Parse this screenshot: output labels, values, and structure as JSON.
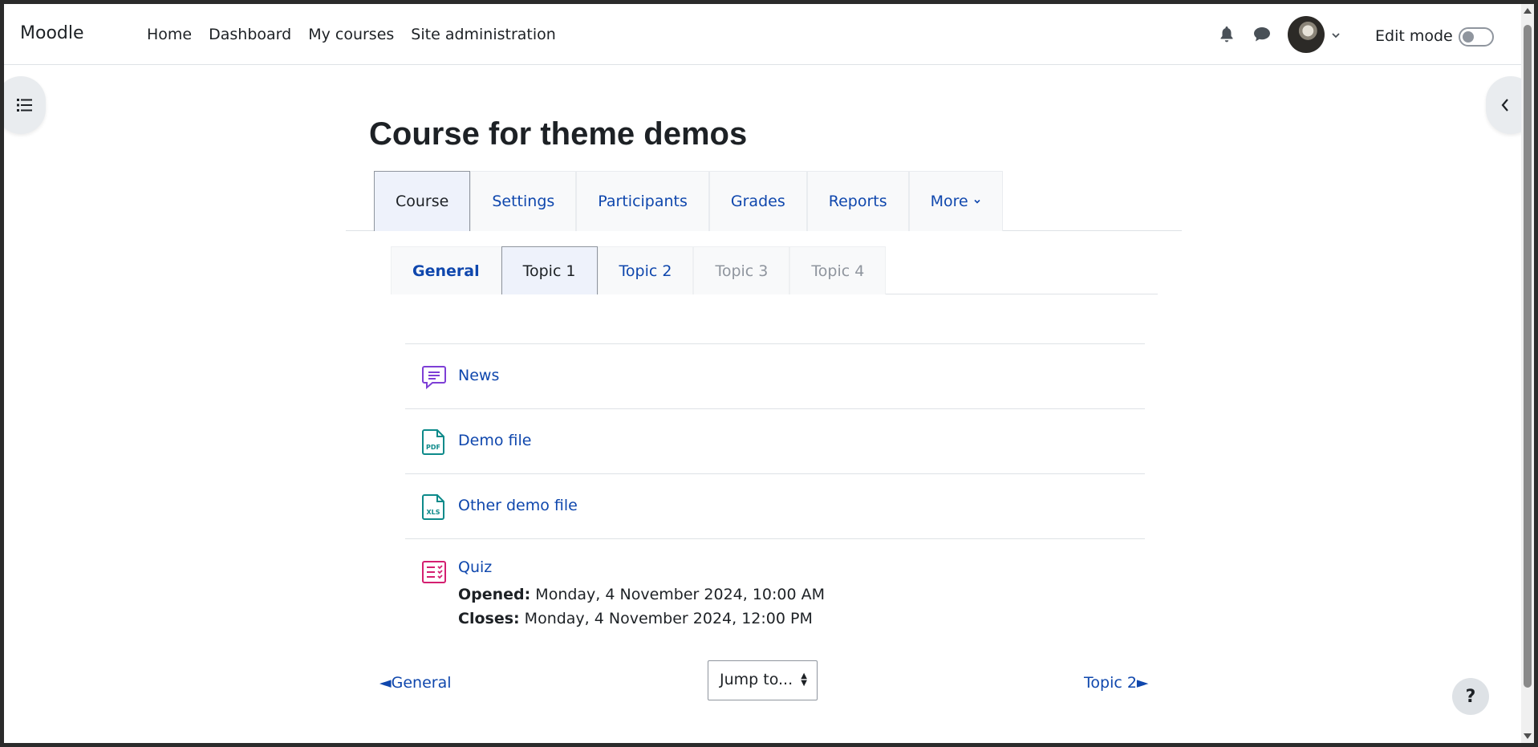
{
  "navbar": {
    "brand": "Moodle",
    "links": [
      "Home",
      "Dashboard",
      "My courses",
      "Site administration"
    ],
    "edit_mode_label": "Edit mode",
    "edit_mode_on": false,
    "icons": [
      "bell-icon",
      "chat-icon",
      "avatar",
      "chevron-down-icon"
    ]
  },
  "page": {
    "title": "Course for theme demos"
  },
  "course_tabs": {
    "items": [
      "Course",
      "Settings",
      "Participants",
      "Grades",
      "Reports",
      "More"
    ],
    "active": "Course"
  },
  "section_tabs": {
    "items": [
      "General",
      "Topic 1",
      "Topic 2",
      "Topic 3",
      "Topic 4"
    ],
    "active": "Topic 1",
    "disabled": [
      "Topic 3",
      "Topic 4"
    ]
  },
  "activities": [
    {
      "name": "News",
      "icon": "forum-icon",
      "icon_color": "#7e3fd6"
    },
    {
      "name": "Demo file",
      "icon": "pdf-file-icon",
      "icon_label": "PDF",
      "icon_color": "#0d8a8a"
    },
    {
      "name": "Other demo file",
      "icon": "xls-file-icon",
      "icon_label": "XLS",
      "icon_color": "#0d8a8a"
    },
    {
      "name": "Quiz",
      "icon": "quiz-icon",
      "icon_color": "#d41f70",
      "opened_label": "Opened:",
      "opened_value": "Monday, 4 November 2024, 10:00 AM",
      "closes_label": "Closes:",
      "closes_value": "Monday, 4 November 2024, 12:00 PM"
    }
  ],
  "bottom_nav": {
    "prev": "◄General",
    "jump": "Jump to...",
    "next": "Topic 2►"
  },
  "help": "?",
  "colors": {
    "link": "#0f47ad",
    "text": "#1d2125",
    "border": "#dee2e6"
  }
}
